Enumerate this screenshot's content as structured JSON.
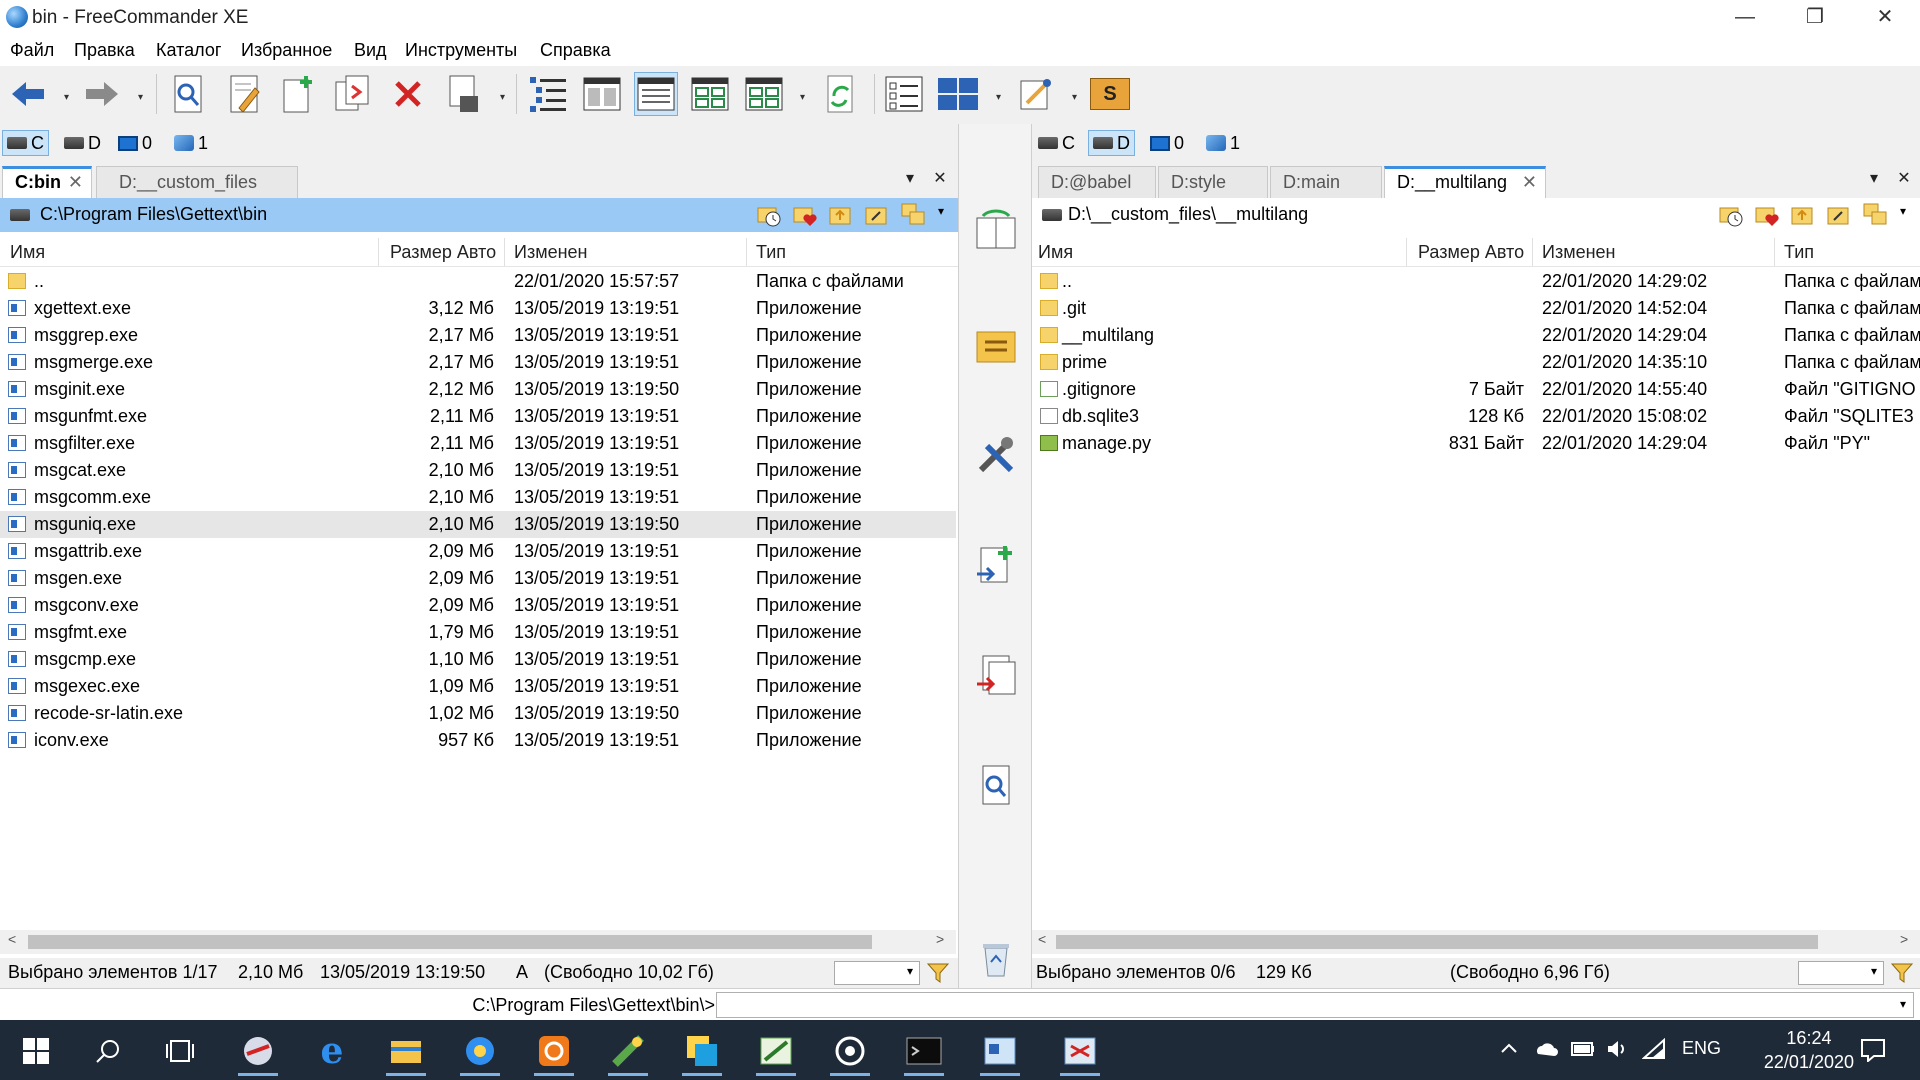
{
  "window": {
    "title": "bin - FreeCommander XE",
    "buttons": {
      "minimize": "—",
      "restore": "❐",
      "close": "✕"
    }
  },
  "menu": [
    "Файл",
    "Правка",
    "Каталог",
    "Избранное",
    "Вид",
    "Инструменты",
    "Справка"
  ],
  "toolbar": {
    "icons": [
      "back-arrow",
      "forward-arrow",
      "view-file",
      "edit-file",
      "new-file",
      "copy",
      "delete",
      "properties",
      "tree-view",
      "brief-view",
      "detail-view",
      "thumbnail-view",
      "thumbnail-view-2",
      "refresh",
      "checklist",
      "layout",
      "settings",
      "script"
    ],
    "script_label": "S",
    "dropdown_glyph": "▾"
  },
  "left_panel": {
    "drives": [
      {
        "label": "C",
        "type": "drive",
        "selected": true
      },
      {
        "label": "D",
        "type": "drive",
        "selected": false
      },
      {
        "label": "0",
        "type": "monitor",
        "selected": false
      },
      {
        "label": "1",
        "type": "network",
        "selected": false
      }
    ],
    "tabs": [
      {
        "label": "C:bin",
        "active": true
      },
      {
        "label": "D:__custom_files",
        "active": false
      }
    ],
    "tab_close_glyph": "✕",
    "path": "C:\\Program Files\\Gettext\\bin",
    "columns": {
      "name": "Имя",
      "size": "Размер Авто",
      "modified": "Изменен",
      "type": "Тип"
    },
    "files": [
      {
        "name": "..",
        "size": "",
        "modified": "22/01/2020 15:57:57",
        "type": "Папка с файлами",
        "icon": "folder",
        "selected": false
      },
      {
        "name": "xgettext.exe",
        "size": "3,12 Мб",
        "modified": "13/05/2019 13:19:51",
        "type": "Приложение",
        "icon": "exe",
        "selected": false
      },
      {
        "name": "msggrep.exe",
        "size": "2,17 Мб",
        "modified": "13/05/2019 13:19:51",
        "type": "Приложение",
        "icon": "exe",
        "selected": false
      },
      {
        "name": "msgmerge.exe",
        "size": "2,17 Мб",
        "modified": "13/05/2019 13:19:51",
        "type": "Приложение",
        "icon": "exe",
        "selected": false
      },
      {
        "name": "msginit.exe",
        "size": "2,12 Мб",
        "modified": "13/05/2019 13:19:50",
        "type": "Приложение",
        "icon": "exe",
        "selected": false
      },
      {
        "name": "msgunfmt.exe",
        "size": "2,11 Мб",
        "modified": "13/05/2019 13:19:51",
        "type": "Приложение",
        "icon": "exe",
        "selected": false
      },
      {
        "name": "msgfilter.exe",
        "size": "2,11 Мб",
        "modified": "13/05/2019 13:19:51",
        "type": "Приложение",
        "icon": "exe",
        "selected": false
      },
      {
        "name": "msgcat.exe",
        "size": "2,10 Мб",
        "modified": "13/05/2019 13:19:51",
        "type": "Приложение",
        "icon": "exe",
        "selected": false
      },
      {
        "name": "msgcomm.exe",
        "size": "2,10 Мб",
        "modified": "13/05/2019 13:19:51",
        "type": "Приложение",
        "icon": "exe",
        "selected": false
      },
      {
        "name": "msguniq.exe",
        "size": "2,10 Мб",
        "modified": "13/05/2019 13:19:50",
        "type": "Приложение",
        "icon": "exe",
        "selected": true
      },
      {
        "name": "msgattrib.exe",
        "size": "2,09 Мб",
        "modified": "13/05/2019 13:19:51",
        "type": "Приложение",
        "icon": "exe",
        "selected": false
      },
      {
        "name": "msgen.exe",
        "size": "2,09 Мб",
        "modified": "13/05/2019 13:19:51",
        "type": "Приложение",
        "icon": "exe",
        "selected": false
      },
      {
        "name": "msgconv.exe",
        "size": "2,09 Мб",
        "modified": "13/05/2019 13:19:51",
        "type": "Приложение",
        "icon": "exe",
        "selected": false
      },
      {
        "name": "msgfmt.exe",
        "size": "1,79 Мб",
        "modified": "13/05/2019 13:19:51",
        "type": "Приложение",
        "icon": "exe",
        "selected": false
      },
      {
        "name": "msgcmp.exe",
        "size": "1,10 Мб",
        "modified": "13/05/2019 13:19:51",
        "type": "Приложение",
        "icon": "exe",
        "selected": false
      },
      {
        "name": "msgexec.exe",
        "size": "1,09 Мб",
        "modified": "13/05/2019 13:19:51",
        "type": "Приложение",
        "icon": "exe",
        "selected": false
      },
      {
        "name": "recode-sr-latin.exe",
        "size": "1,02 Мб",
        "modified": "13/05/2019 13:19:50",
        "type": "Приложение",
        "icon": "exe",
        "selected": false
      },
      {
        "name": "iconv.exe",
        "size": "957 Кб",
        "modified": "13/05/2019 13:19:51",
        "type": "Приложение",
        "icon": "exe",
        "selected": false
      }
    ],
    "status": {
      "selected": "Выбрано элементов 1/17",
      "size": "2,10 Мб",
      "date": "13/05/2019 13:19:50",
      "attr": "A",
      "free": "(Свободно 10,02 Гб)"
    }
  },
  "right_panel": {
    "drives": [
      {
        "label": "C",
        "type": "drive",
        "selected": false
      },
      {
        "label": "D",
        "type": "drive",
        "selected": true
      },
      {
        "label": "0",
        "type": "monitor",
        "selected": false
      },
      {
        "label": "1",
        "type": "network",
        "selected": false
      }
    ],
    "tabs": [
      {
        "label": "D:@babel",
        "active": false
      },
      {
        "label": "D:style",
        "active": false
      },
      {
        "label": "D:main",
        "active": false
      },
      {
        "label": "D:__multilang",
        "active": true
      }
    ],
    "tab_close_glyph": "✕",
    "path": "D:\\__custom_files\\__multilang",
    "columns": {
      "name": "Имя",
      "size": "Размер Авто",
      "modified": "Изменен",
      "type": "Тип"
    },
    "files": [
      {
        "name": "..",
        "size": "",
        "modified": "22/01/2020 14:29:02",
        "type": "Папка с файлам",
        "icon": "folder",
        "selected": false
      },
      {
        "name": ".git",
        "size": "",
        "modified": "22/01/2020 14:52:04",
        "type": "Папка с файлам",
        "icon": "folder",
        "selected": false
      },
      {
        "name": "__multilang",
        "size": "",
        "modified": "22/01/2020 14:29:04",
        "type": "Папка с файлам",
        "icon": "folder",
        "selected": false
      },
      {
        "name": "prime",
        "size": "",
        "modified": "22/01/2020 14:35:10",
        "type": "Папка с файлам",
        "icon": "folder",
        "selected": false
      },
      {
        "name": ".gitignore",
        "size": "7 Байт",
        "modified": "22/01/2020 14:55:40",
        "type": "Файл \"GITIGNO",
        "icon": "txt",
        "selected": false
      },
      {
        "name": "db.sqlite3",
        "size": "128 Кб",
        "modified": "22/01/2020 15:08:02",
        "type": "Файл \"SQLITE3",
        "icon": "file",
        "selected": false
      },
      {
        "name": "manage.py",
        "size": "831 Байт",
        "modified": "22/01/2020 14:29:04",
        "type": "Файл \"PY\"",
        "icon": "py",
        "selected": false
      }
    ],
    "status": {
      "selected": "Выбрано элементов 0/6",
      "size": "129 Кб",
      "free": "(Свободно 6,96 Гб)"
    }
  },
  "panel_controls": {
    "dropdown_glyph": "▾",
    "close_glyph": "✕"
  },
  "command_line": {
    "label": "C:\\Program Files\\Gettext\\bin\\>",
    "value": ""
  },
  "taskbar": {
    "apps": [
      "windows-start",
      "search",
      "task-view",
      "app-1",
      "edge",
      "file-explorer",
      "app-2",
      "app-3",
      "app-4",
      "app-5",
      "app-6",
      "app-7",
      "cmd",
      "app-8",
      "freecommander"
    ],
    "tray": {
      "lang": "ENG",
      "time": "16:24",
      "date": "22/01/2020"
    }
  }
}
